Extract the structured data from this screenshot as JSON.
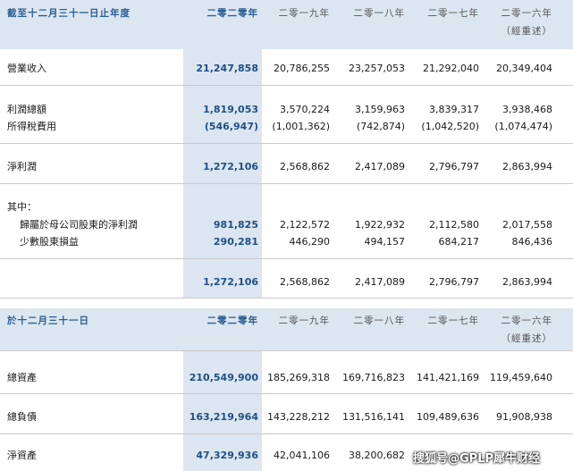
{
  "section1": {
    "header_label": "截至十二月三十一日止年度",
    "years": [
      "二零二零年",
      "二零一九年",
      "二零一八年",
      "二零一七年",
      "二零一六年"
    ],
    "restated": "（經重述）",
    "rows": [
      {
        "label": "營業收入",
        "values": [
          "21,247,858",
          "20,786,255",
          "23,257,053",
          "21,292,040",
          "20,349,404"
        ]
      },
      {
        "label": "利潤總額",
        "values": [
          "1,819,053",
          "3,570,224",
          "3,159,963",
          "3,839,317",
          "3,938,468"
        ]
      },
      {
        "label": "所得稅費用",
        "values": [
          "(546,947)",
          "(1,001,362)",
          "(742,874)",
          "(1,042,520)",
          "(1,074,474)"
        ]
      },
      {
        "label": "淨利潤",
        "values": [
          "1,272,106",
          "2,568,862",
          "2,417,089",
          "2,796,797",
          "2,863,994"
        ]
      },
      {
        "label": "其中：",
        "values": [
          "",
          "",
          "",
          "",
          ""
        ]
      },
      {
        "label": "歸屬於母公司股東的淨利潤",
        "values": [
          "981,825",
          "2,122,572",
          "1,922,932",
          "2,112,580",
          "2,017,558"
        ]
      },
      {
        "label": "少數股東損益",
        "values": [
          "290,281",
          "446,290",
          "494,157",
          "684,217",
          "846,436"
        ]
      },
      {
        "label": "",
        "values": [
          "1,272,106",
          "2,568,862",
          "2,417,089",
          "2,796,797",
          "2,863,994"
        ]
      }
    ]
  },
  "section2": {
    "header_label": "於十二月三十一日",
    "years": [
      "二零二零年",
      "二零一九年",
      "二零一八年",
      "二零一七年",
      "二零一六年"
    ],
    "restated": "（經重述）",
    "rows": [
      {
        "label": "總資產",
        "values": [
          "210,549,900",
          "185,269,318",
          "169,716,823",
          "141,421,169",
          "119,459,640"
        ]
      },
      {
        "label": "總負債",
        "values": [
          "163,219,964",
          "143,228,212",
          "131,516,141",
          "109,489,636",
          "91,908,938"
        ]
      },
      {
        "label": "淨資產",
        "values": [
          "47,329,936",
          "42,041,106",
          "38,200,682",
          "",
          ""
        ]
      }
    ]
  },
  "watermark": "搜狐号@GPLP犀牛财经",
  "colors": {
    "accent": "#2a5e95",
    "highlight": "#dce6f0"
  }
}
